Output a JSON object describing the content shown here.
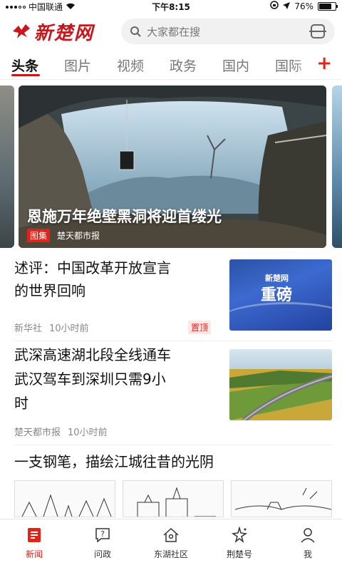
{
  "status_bar": {
    "carrier": "中国联通",
    "time": "下午8:15",
    "battery": "76%",
    "battery_level": 0.76
  },
  "header": {
    "logo_text": "新楚网",
    "search_placeholder": "大家都在搜"
  },
  "tabs": {
    "items": [
      "头条",
      "图片",
      "视频",
      "政务",
      "国内",
      "国际"
    ],
    "active_index": 0,
    "add_label": "+"
  },
  "hero": {
    "title": "恩施万年绝壁黑洞将迎首缕光",
    "badge": "图集",
    "source": "楚天都市报"
  },
  "articles": [
    {
      "title_line1": "述评：中国改革开放宣言",
      "title_line2": "的世界回响",
      "source": "新华社",
      "time": "10小时前",
      "badge": "置顶",
      "thumb_logo": "新楚网",
      "thumb_text": "重磅"
    },
    {
      "title_line1": "武深高速湖北段全线通车",
      "title_line2": "武汉驾车到深圳只需9小",
      "title_line3": "时",
      "source": "楚天都市报",
      "time": "10小时前"
    },
    {
      "title": "一支钢笔，描绘江城往昔的光阴"
    }
  ],
  "bottom_nav": {
    "items": [
      "新闻",
      "问政",
      "东湖社区",
      "荆楚号",
      "我"
    ],
    "active_index": 0,
    "icons": [
      "news-icon",
      "question-icon",
      "home-icon",
      "sparkle-icon",
      "user-icon"
    ]
  },
  "colors": {
    "accent": "#e2231a",
    "logo_red": "#c8161d"
  }
}
